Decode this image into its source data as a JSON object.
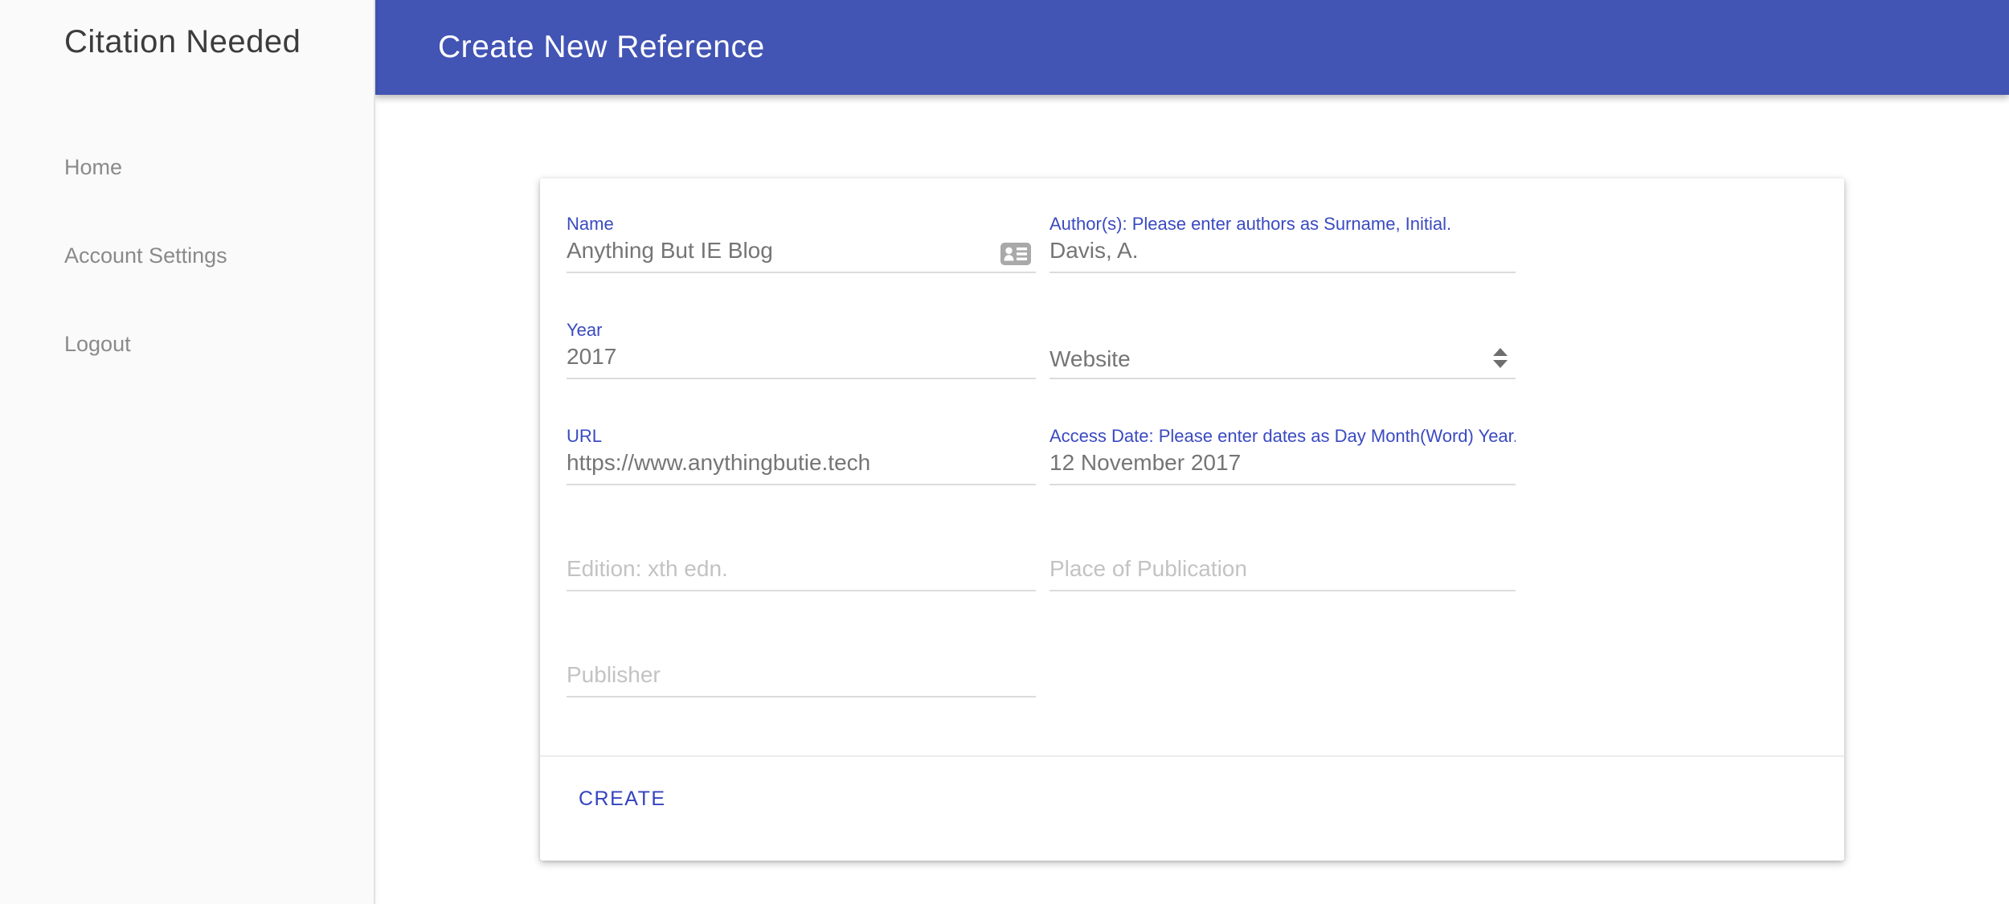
{
  "app": {
    "title": "Citation Needed"
  },
  "sidebar": {
    "items": [
      {
        "label": "Home"
      },
      {
        "label": "Account Settings"
      },
      {
        "label": "Logout"
      }
    ]
  },
  "header": {
    "title": "Create New Reference"
  },
  "form": {
    "fields": {
      "name": {
        "label": "Name",
        "value": "Anything But IE Blog"
      },
      "authors": {
        "label": "Author(s): Please enter authors as Surname, Initial.",
        "value": "Davis, A."
      },
      "year": {
        "label": "Year",
        "value": "2017"
      },
      "reference_type": {
        "value": "Website"
      },
      "url": {
        "label": "URL",
        "value": "https://www.anythingbutie.tech"
      },
      "access_date": {
        "label": "Access Date: Please enter dates as Day Month(Word) Year.",
        "value": "12 November 2017"
      },
      "edition": {
        "placeholder": "Edition: xth edn."
      },
      "place_of_publication": {
        "placeholder": "Place of Publication"
      },
      "publisher": {
        "placeholder": "Publisher"
      }
    },
    "create_label": "CREATE"
  },
  "icons": {
    "contact_card": "contact-card-icon",
    "select_spinner": "select-spinner-icon"
  },
  "colors": {
    "header_bg": "#4254b4",
    "label_blue": "#3a4ac1",
    "create_blue": "#3443c0",
    "value_gray": "#757575",
    "placeholder_gray": "#c3c3c3",
    "sidebar_bg": "#fafafa",
    "sidebar_text": "#8a8a8a",
    "app_title_color": "#3c3c3c",
    "underline": "#dcdcdc"
  }
}
